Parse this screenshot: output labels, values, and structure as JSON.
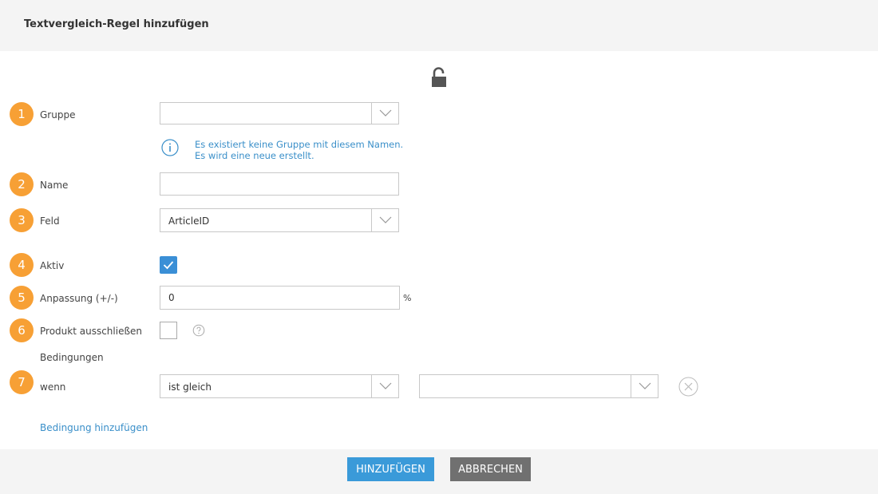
{
  "dialog": {
    "title": "Textvergleich-Regel hinzufügen"
  },
  "icons": {
    "lock": "unlocked-padlock-icon",
    "info": "info-icon",
    "help": "question-mark-icon",
    "remove": "close-circle-icon",
    "dropdown": "chevron-down-icon",
    "check": "checkmark-icon"
  },
  "colors": {
    "badge": "#f7a035",
    "accent": "#3a9ad9",
    "link": "#3a8fc9",
    "secondary": "#707070",
    "header_bg": "#f4f4f4"
  },
  "form": {
    "gruppe": {
      "step": "1",
      "label": "Gruppe",
      "value": ""
    },
    "info": {
      "line1": "Es existiert keine Gruppe mit diesem Namen.",
      "line2": "Es wird eine neue erstellt."
    },
    "name": {
      "step": "2",
      "label": "Name",
      "value": ""
    },
    "feld": {
      "step": "3",
      "label": "Feld",
      "value": "ArticleID"
    },
    "aktiv": {
      "step": "4",
      "label": "Aktiv",
      "checked": true
    },
    "anpassung": {
      "step": "5",
      "label": "Anpassung (+/-)",
      "value": "0",
      "unit": "%"
    },
    "produkt": {
      "step": "6",
      "label": "Produkt ausschließen",
      "checked": false
    },
    "bedingungen": {
      "heading": "Bedingungen"
    },
    "wenn": {
      "step": "7",
      "label": "wenn",
      "operator": "ist gleich",
      "value": ""
    },
    "add_condition": "Bedingung hinzufügen"
  },
  "footer": {
    "add_label": "HINZUFÜGEN",
    "cancel_label": "ABBRECHEN"
  }
}
